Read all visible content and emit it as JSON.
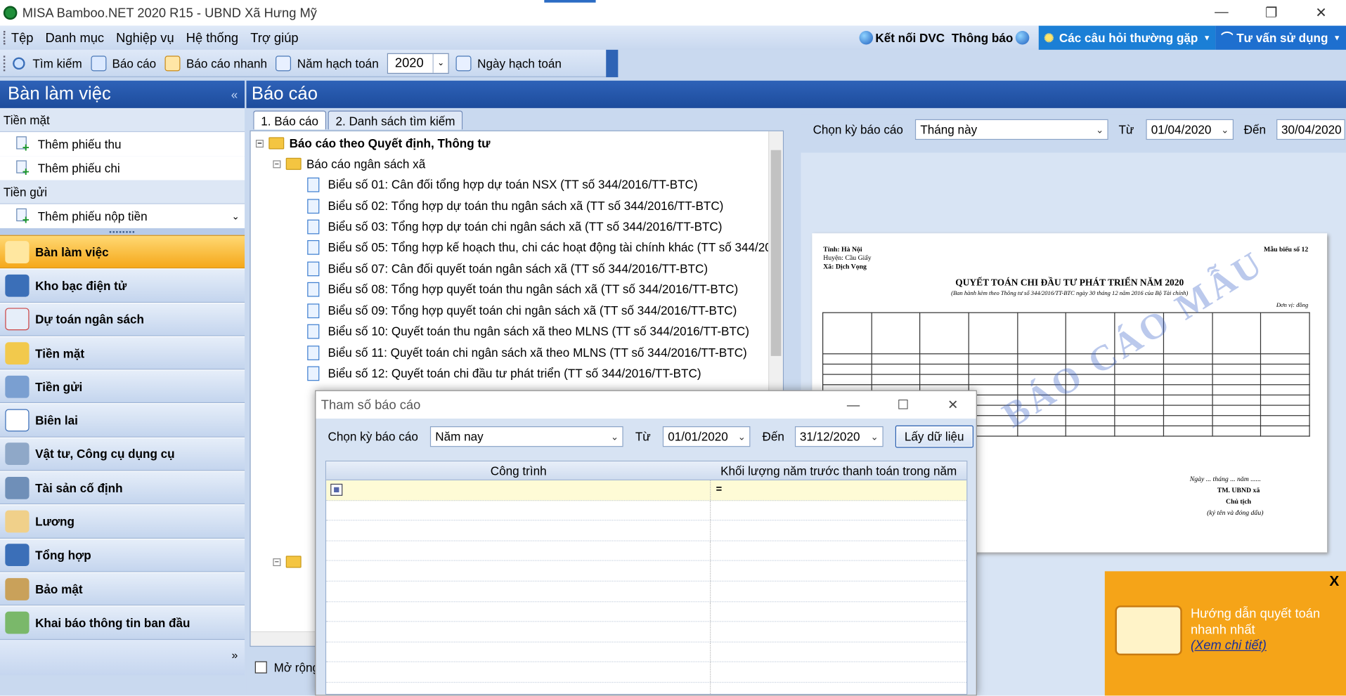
{
  "window": {
    "title": "MISA Bamboo.NET 2020 R15 - UBND Xã Hưng Mỹ",
    "min": "—",
    "restore": "❐",
    "close": "✕"
  },
  "menu": [
    "Tệp",
    "Danh mục",
    "Nghiệp vụ",
    "Hệ thống",
    "Trợ giúp"
  ],
  "menu_right": {
    "connect": "Kết nối DVC",
    "notify": "Thông báo",
    "faq": "Các câu hỏi thường gặp",
    "support": "Tư vấn sử dụng"
  },
  "toolbar": {
    "search": "Tìm kiếm",
    "report": "Báo cáo",
    "quick_report": "Báo cáo nhanh",
    "fiscal_year": "Năm hạch toán",
    "year_value": "2020",
    "posting_date": "Ngày hạch toán"
  },
  "left": {
    "header": "Bàn làm việc",
    "groups": [
      {
        "label": "Tiền mặt",
        "items": [
          "Thêm phiếu thu",
          "Thêm phiếu chi"
        ]
      },
      {
        "label": "Tiền gửi",
        "items": [
          "Thêm phiếu nộp tiền"
        ]
      }
    ],
    "nav": [
      "Bàn làm việc",
      "Kho bạc điện tử",
      "Dự toán ngân sách",
      "Tiền mặt",
      "Tiền gửi",
      "Biên lai",
      "Vật tư, Công cụ dụng cụ",
      "Tài sản cố định",
      "Lương",
      "Tổng hợp",
      "Bảo mật",
      "Khai báo thông tin ban đầu"
    ]
  },
  "report": {
    "header": "Báo cáo",
    "tabs": [
      "1. Báo cáo",
      "2. Danh sách tìm kiếm"
    ],
    "tree_root": "Báo cáo theo Quyết định, Thông tư",
    "tree_folder": "Báo cáo ngân sách xã",
    "tree_items": [
      "Biểu số 01: Cân đối tổng hợp dự toán NSX (TT số 344/2016/TT-BTC)",
      "Biểu số 02: Tổng hợp dự toán thu ngân sách xã (TT số 344/2016/TT-BTC)",
      "Biểu số 03: Tổng hợp dự toán chi ngân sách xã (TT số 344/2016/TT-BTC)",
      "Biểu số 05: Tổng hợp kế hoạch thu, chi các hoạt động tài chính khác (TT số 344/20",
      "Biểu số 07: Cân đối quyết toán ngân sách xã (TT số 344/2016/TT-BTC)",
      "Biểu số 08: Tổng hợp quyết toán thu ngân sách xã (TT số 344/2016/TT-BTC)",
      "Biểu số 09: Tổng hợp quyết toán chi ngân sách xã (TT số 344/2016/TT-BTC)",
      "Biểu số 10: Quyết toán thu ngân sách xã theo MLNS (TT số 344/2016/TT-BTC)",
      "Biểu số 11: Quyết toán chi ngân sách xã theo MLNS (TT số 344/2016/TT-BTC)",
      "Biểu số 12: Quyết toán chi đầu tư phát triển (TT số 344/2016/TT-BTC)"
    ],
    "expand_label": "Mở rộng",
    "criteria": {
      "period_label": "Chọn kỳ báo cáo",
      "period_value": "Tháng này",
      "from_label": "Từ",
      "from_value": "01/04/2020",
      "to_label": "Đến",
      "to_value": "30/04/2020"
    },
    "preview": {
      "province": "Tỉnh: Hà Nội",
      "district": "Huyện: Cầu Giấy",
      "commune": "Xã: Dịch Vọng",
      "form_no": "Mẫu biểu số 12",
      "title": "QUYẾT TOÁN CHI ĐẦU TƯ PHÁT TRIỂN NĂM 2020",
      "subtitle": "(Ban hành kèm theo Thông tư số 344/2016/TT-BTC ngày 30 tháng 12 năm 2016 của Bộ Tài chính)",
      "unit": "Đơn vị: đồng",
      "watermark": "BÁO CÁO MẪU",
      "sign_date": "Ngày ... tháng ... năm ......",
      "sign_org": "TM. UBND xã",
      "sign_role": "Chủ tịch",
      "sign_note": "(ký tên và đóng dấu)"
    }
  },
  "banner": {
    "close": "X",
    "text": "Hướng dẫn quyết toán nhanh nhất",
    "link": "(Xem chi tiết)"
  },
  "dialog": {
    "title": "Tham số báo cáo",
    "period_label": "Chọn kỳ báo cáo",
    "period_value": "Năm nay",
    "from_label": "Từ",
    "from_value": "01/01/2020",
    "to_label": "Đến",
    "to_value": "31/12/2020",
    "fetch_button": "Lấy dữ liệu",
    "columns": [
      "Công trình",
      "Khối lượng năm trước thanh toán trong năm"
    ]
  },
  "colors": {
    "header_blue": "#1d4c9c",
    "active_nav": "#f5a81a",
    "banner": "#f5a418",
    "link": "#1b2f9a"
  }
}
